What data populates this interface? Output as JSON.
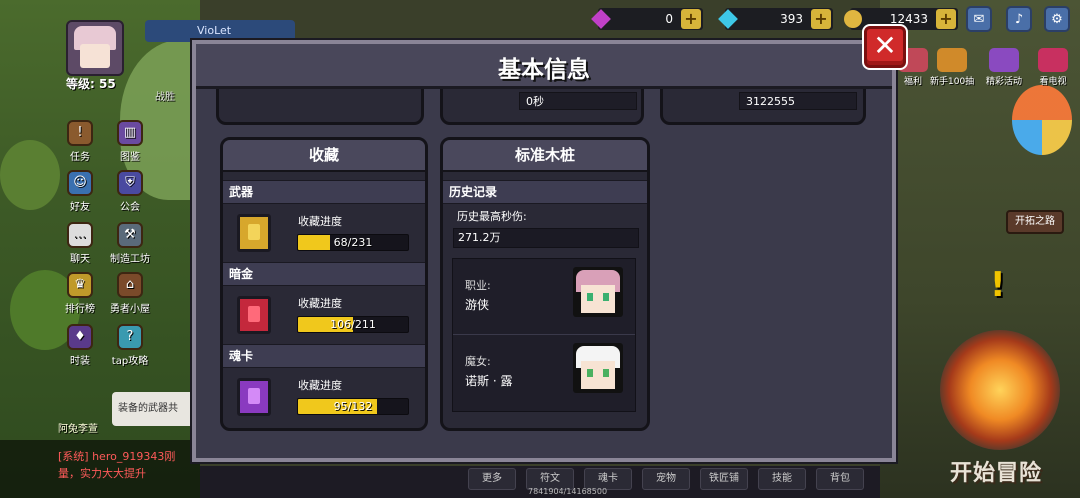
{
  "hud": {
    "player_name": "VioLet",
    "level": "等级: 55",
    "victory": "战胜",
    "resources": [
      {
        "icon": "purple-gem-icon",
        "value": "0"
      },
      {
        "icon": "blue-diamond-icon",
        "value": "393"
      },
      {
        "icon": "gold-coin-icon",
        "value": "12433"
      }
    ],
    "top_buttons": [
      "mail-icon",
      "sound-icon",
      "settings-icon"
    ],
    "top_right_items": [
      "福利",
      "新手100抽",
      "精彩活动",
      "看电视"
    ]
  },
  "left_menu": [
    {
      "label": "任务",
      "icon": "task-icon"
    },
    {
      "label": "图鉴",
      "icon": "codex-icon"
    },
    {
      "label": "好友",
      "icon": "friends-icon"
    },
    {
      "label": "公会",
      "icon": "guild-icon"
    },
    {
      "label": "聊天",
      "icon": "chat-icon"
    },
    {
      "label": "制造工坊",
      "icon": "workshop-icon"
    },
    {
      "label": "排行榜",
      "icon": "trophy-icon"
    },
    {
      "label": "勇者小屋",
      "icon": "house-icon"
    },
    {
      "label": "时装",
      "icon": "costume-icon"
    },
    {
      "label": "tap攻略",
      "icon": "guide-icon"
    }
  ],
  "quest_tip": "装备的武器共",
  "rabbit_label": "阿兔李萱",
  "chat": {
    "line1": "[系统] hero_919343刚",
    "line2": "量，实力大大提升"
  },
  "pioneer_label": "开拓之路",
  "start_button": "开始冒险",
  "bottom_tabs": [
    "更多",
    "符文",
    "魂卡",
    "宠物",
    "铁匠铺",
    "技能",
    "背包"
  ],
  "exp_text": "7841904/14168500",
  "modal": {
    "title": "基本信息",
    "top_values": {
      "time": "0秒",
      "number": "3122555"
    },
    "collection": {
      "title": "收藏",
      "sections": [
        {
          "name": "武器",
          "progress_label": "收藏进度",
          "progress_text": "68/231",
          "current": 68,
          "total": 231,
          "color": "#d7a72c",
          "inner": "#f3d45a"
        },
        {
          "name": "暗金",
          "progress_label": "收藏进度",
          "progress_text": "106/211",
          "current": 106,
          "total": 211,
          "color": "#c4283c",
          "inner": "#ff6a7a"
        },
        {
          "name": "魂卡",
          "progress_label": "收藏进度",
          "progress_text": "95/132",
          "current": 95,
          "total": 132,
          "color": "#8a3ac0",
          "inner": "#d48af7"
        }
      ]
    },
    "dummy": {
      "title": "标准木桩",
      "history_title": "历史记录",
      "max_dps_label": "历史最高秒伤:",
      "max_dps_value": "271.2万",
      "class_label": "职业:",
      "class_value": "游侠",
      "witch_label": "魔女:",
      "witch_value": "诺斯 · 露"
    }
  }
}
